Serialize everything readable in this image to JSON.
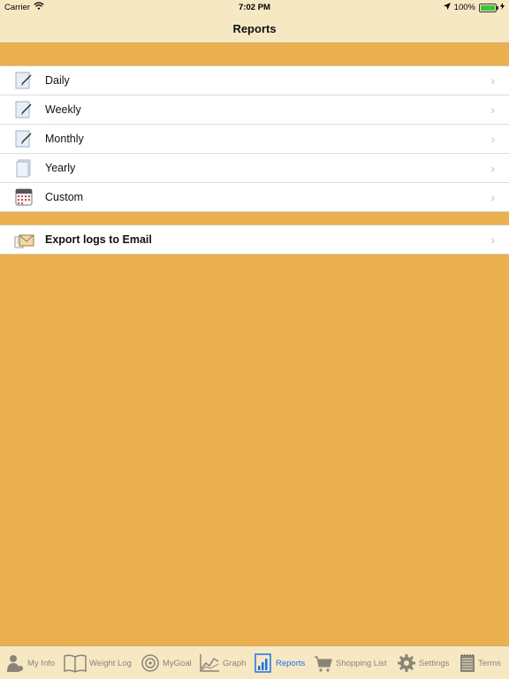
{
  "status": {
    "carrier": "Carrier",
    "time": "7:02 PM",
    "battery": "100%"
  },
  "nav": {
    "title": "Reports"
  },
  "reports": [
    {
      "label": "Daily",
      "icon": "notepad-icon"
    },
    {
      "label": "Weekly",
      "icon": "notepad-icon"
    },
    {
      "label": "Monthly",
      "icon": "notepad-icon"
    },
    {
      "label": "Yearly",
      "icon": "document-icon"
    },
    {
      "label": "Custom",
      "icon": "calendar-icon"
    }
  ],
  "export": {
    "label": "Export logs to Email",
    "icon": "envelope-icon"
  },
  "tabs": [
    {
      "label": "My Info",
      "icon": "person-icon",
      "active": false
    },
    {
      "label": "Weight Log",
      "icon": "book-icon",
      "active": false
    },
    {
      "label": "MyGoal",
      "icon": "target-icon",
      "active": false
    },
    {
      "label": "Graph",
      "icon": "graph-icon",
      "active": false
    },
    {
      "label": "Reports",
      "icon": "report-icon",
      "active": true
    },
    {
      "label": "Shopping List",
      "icon": "cart-icon",
      "active": false
    },
    {
      "label": "Settings",
      "icon": "gear-icon",
      "active": false
    },
    {
      "label": "Terms",
      "icon": "notes-icon",
      "active": false
    }
  ],
  "colors": {
    "background": "#ebb050",
    "bar": "#f7e8c4",
    "active_tab": "#1a73e8"
  }
}
